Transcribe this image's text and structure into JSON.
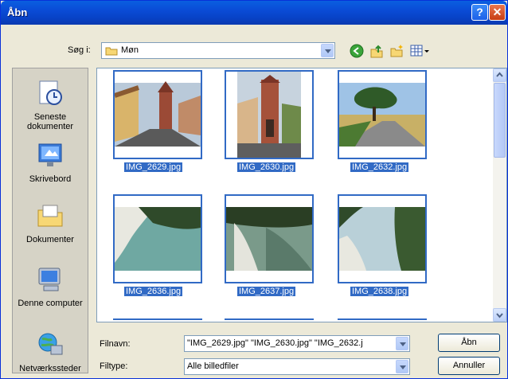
{
  "window": {
    "title": "Åbn",
    "help_glyph": "?",
    "close_glyph": "✕"
  },
  "lookin": {
    "label": "Søg i:",
    "value": "Møn"
  },
  "places": [
    {
      "label": "Seneste dokumenter",
      "icon": "recent-documents-icon"
    },
    {
      "label": "Skrivebord",
      "icon": "desktop-icon"
    },
    {
      "label": "Dokumenter",
      "icon": "my-documents-icon"
    },
    {
      "label": "Denne computer",
      "icon": "my-computer-icon"
    },
    {
      "label": "Netværkssteder",
      "icon": "network-places-icon"
    }
  ],
  "files": [
    {
      "name": "IMG_2629.jpg"
    },
    {
      "name": "IMG_2630.jpg"
    },
    {
      "name": "IMG_2632.jpg"
    },
    {
      "name": "IMG_2636.jpg"
    },
    {
      "name": "IMG_2637.jpg"
    },
    {
      "name": "IMG_2638.jpg"
    }
  ],
  "filename": {
    "label": "Filnavn:",
    "value": "\"IMG_2629.jpg\" \"IMG_2630.jpg\" \"IMG_2632.j"
  },
  "filetype": {
    "label": "Filtype:",
    "value": "Alle billedfiler"
  },
  "buttons": {
    "open": "Åbn",
    "cancel": "Annuller"
  },
  "colors": {
    "selection": "#316ac5",
    "title_bar": "#0a4bd6"
  }
}
